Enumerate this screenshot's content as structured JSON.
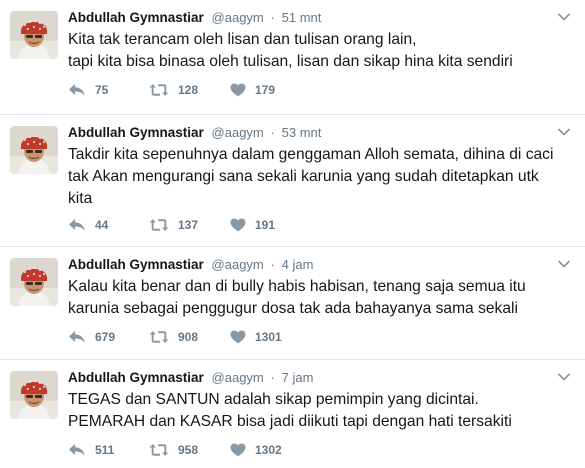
{
  "tweets": [
    {
      "name": "Abdullah Gymnastiar",
      "handle": "@aagym",
      "dot": "·",
      "time": "51 mnt",
      "text": "Kita tak terancam oleh lisan  dan tulisan orang lain,\ntapi kita bisa binasa oleh tulisan, lisan dan sikap hina kita sendiri",
      "replies": "75",
      "retweets": "128",
      "likes": "179"
    },
    {
      "name": "Abdullah Gymnastiar",
      "handle": "@aagym",
      "dot": "·",
      "time": "53 mnt",
      "text": "Takdir kita sepenuhnya dalam genggaman Alloh semata, dihina di caci\ntak Akan mengurangi sana sekali karunia yang sudah ditetapkan utk\nkita",
      "replies": "44",
      "retweets": "137",
      "likes": "191"
    },
    {
      "name": "Abdullah Gymnastiar",
      "handle": "@aagym",
      "dot": "·",
      "time": "4 jam",
      "text": "Kalau kita benar dan di bully habis habisan, tenang saja semua itu\nkarunia sebagai penggugur dosa tak ada bahayanya sama sekali",
      "replies": "679",
      "retweets": "908",
      "likes": "1301"
    },
    {
      "name": "Abdullah Gymnastiar",
      "handle": "@aagym",
      "dot": "·",
      "time": "7 jam",
      "text": "TEGAS dan SANTUN adalah sikap pemimpin yang dicintai.\nPEMARAH dan KASAR bisa jadi diikuti tapi dengan hati tersakiti",
      "replies": "511",
      "retweets": "958",
      "likes": "1302"
    }
  ],
  "colors": {
    "text": "#14171a",
    "muted": "#657786",
    "icon": "#8899a6",
    "divider": "#e1e8ed",
    "avatar_cap": "#c0392b"
  },
  "icons": [
    "reply-icon",
    "retweet-icon",
    "like-icon",
    "chevron-down-icon"
  ]
}
